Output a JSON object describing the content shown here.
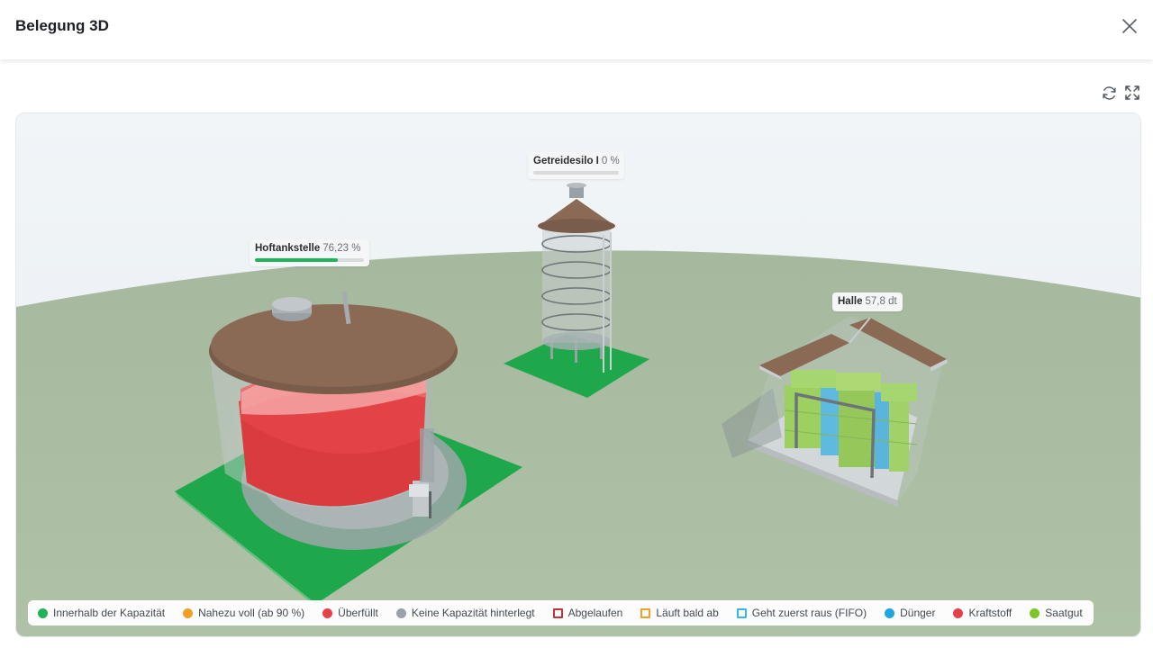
{
  "header": {
    "title": "Belegung 3D"
  },
  "icons": {
    "close": "close-icon",
    "refresh": "refresh-icon",
    "fullscreen": "fullscreen-icon"
  },
  "objects": {
    "tank": {
      "name": "Hoftankstelle",
      "value": "76,23 %",
      "fill": 0.7623
    },
    "silo": {
      "name": "Getreidesilo I",
      "value": "0 %",
      "fill": 0.0
    },
    "hall": {
      "name": "Halle",
      "value": "57,8 dt"
    }
  },
  "legend": [
    {
      "label": "Innerhalb der Kapazität",
      "color": "#22b35a",
      "shape": "dot"
    },
    {
      "label": "Nahezu voll (ab 90 %)",
      "color": "#f2a024",
      "shape": "dot"
    },
    {
      "label": "Überfüllt",
      "color": "#e5414b",
      "shape": "dot"
    },
    {
      "label": "Keine Kapazität hinterlegt",
      "color": "#9aa1ad",
      "shape": "dot"
    },
    {
      "label": "Abgelaufen",
      "color": "#c8303a",
      "shape": "square"
    },
    {
      "label": "Läuft bald ab",
      "color": "#f2a024",
      "shape": "square"
    },
    {
      "label": "Geht zuerst raus (FIFO)",
      "color": "#39b6e6",
      "shape": "square"
    },
    {
      "label": "Dünger",
      "color": "#1fa6dd",
      "shape": "dot"
    },
    {
      "label": "Kraftstoff",
      "color": "#e5414b",
      "shape": "dot"
    },
    {
      "label": "Saatgut",
      "color": "#7cc52b",
      "shape": "dot"
    }
  ]
}
